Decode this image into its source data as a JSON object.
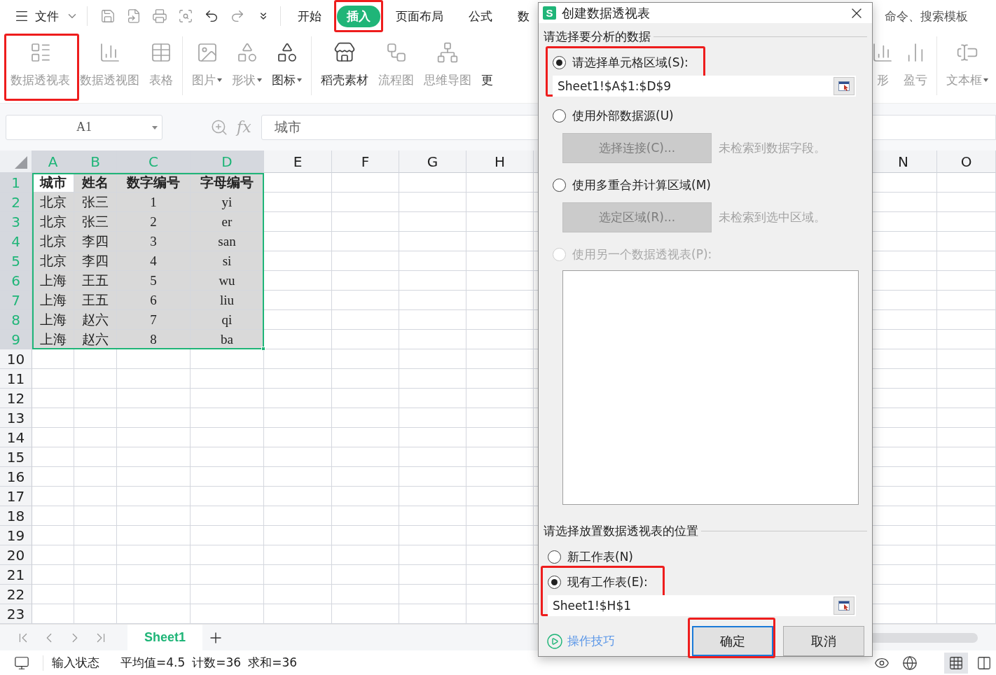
{
  "menu": {
    "file": "文件",
    "tabs": [
      {
        "label": "开始",
        "selected": false,
        "annotated": false
      },
      {
        "label": "插入",
        "selected": true,
        "annotated": true
      },
      {
        "label": "页面布局",
        "selected": false,
        "annotated": false
      },
      {
        "label": "公式",
        "selected": false,
        "annotated": false
      },
      {
        "label": "数",
        "selected": false,
        "annotated": false
      }
    ],
    "search_hint": "命令、搜索模板"
  },
  "ribbon": {
    "groups": [
      [
        {
          "label": "数据透视表",
          "disabled": true,
          "dropdown": false,
          "annotated": true
        },
        {
          "label": "数据透视图",
          "disabled": true,
          "dropdown": false,
          "annotated": false
        },
        {
          "label": "表格",
          "disabled": true,
          "dropdown": false,
          "annotated": false
        }
      ],
      [
        {
          "label": "图片",
          "disabled": true,
          "dropdown": true,
          "annotated": false
        },
        {
          "label": "形状",
          "disabled": true,
          "dropdown": true,
          "annotated": false
        },
        {
          "label": "图标",
          "disabled": false,
          "dropdown": true,
          "annotated": false
        }
      ],
      [
        {
          "label": "稻壳素材",
          "disabled": false,
          "dropdown": false,
          "annotated": false
        },
        {
          "label": "流程图",
          "disabled": true,
          "dropdown": false,
          "annotated": false
        },
        {
          "label": "思维导图",
          "disabled": true,
          "dropdown": false,
          "annotated": false
        },
        {
          "label": "更",
          "disabled": false,
          "dropdown": false,
          "annotated": false
        }
      ]
    ],
    "right_groups": [
      [
        {
          "label": "形",
          "disabled": true,
          "dropdown": false,
          "annotated": false
        },
        {
          "label": "盈亏",
          "disabled": true,
          "dropdown": false,
          "annotated": false
        }
      ],
      [
        {
          "label": "文本框",
          "disabled": true,
          "dropdown": true,
          "annotated": false
        }
      ]
    ]
  },
  "formula_bar": {
    "name_box": "A1",
    "fx": "fx",
    "value": "城市"
  },
  "sheet": {
    "columns": [
      {
        "label": "A",
        "selected": true
      },
      {
        "label": "B",
        "selected": true
      },
      {
        "label": "C",
        "selected": true
      },
      {
        "label": "D",
        "selected": true
      },
      {
        "label": "E",
        "selected": false
      },
      {
        "label": "F",
        "selected": false
      },
      {
        "label": "G",
        "selected": false
      },
      {
        "label": "H",
        "selected": false
      }
    ],
    "far_columns": [
      {
        "label": "N",
        "selected": false
      },
      {
        "label": "O",
        "selected": false
      }
    ],
    "rows": [
      {
        "number": "1",
        "selected": true,
        "kind": "header",
        "cells": [
          {
            "text": "城市",
            "active": true
          },
          {
            "text": "姓名",
            "active": false
          },
          {
            "text": "数字编号",
            "active": false
          },
          {
            "text": "字母编号",
            "active": false
          }
        ]
      },
      {
        "number": "2",
        "selected": true,
        "kind": "data",
        "cells": [
          {
            "text": "北京",
            "active": false
          },
          {
            "text": "张三",
            "active": false
          },
          {
            "text": "1",
            "active": false
          },
          {
            "text": "yi",
            "active": false
          }
        ]
      },
      {
        "number": "3",
        "selected": true,
        "kind": "data",
        "cells": [
          {
            "text": "北京",
            "active": false
          },
          {
            "text": "张三",
            "active": false
          },
          {
            "text": "2",
            "active": false
          },
          {
            "text": "er",
            "active": false
          }
        ]
      },
      {
        "number": "4",
        "selected": true,
        "kind": "data",
        "cells": [
          {
            "text": "北京",
            "active": false
          },
          {
            "text": "李四",
            "active": false
          },
          {
            "text": "3",
            "active": false
          },
          {
            "text": "san",
            "active": false
          }
        ]
      },
      {
        "number": "5",
        "selected": true,
        "kind": "data",
        "cells": [
          {
            "text": "北京",
            "active": false
          },
          {
            "text": "李四",
            "active": false
          },
          {
            "text": "4",
            "active": false
          },
          {
            "text": "si",
            "active": false
          }
        ]
      },
      {
        "number": "6",
        "selected": true,
        "kind": "data",
        "cells": [
          {
            "text": "上海",
            "active": false
          },
          {
            "text": "王五",
            "active": false
          },
          {
            "text": "5",
            "active": false
          },
          {
            "text": "wu",
            "active": false
          }
        ]
      },
      {
        "number": "7",
        "selected": true,
        "kind": "data",
        "cells": [
          {
            "text": "上海",
            "active": false
          },
          {
            "text": "王五",
            "active": false
          },
          {
            "text": "6",
            "active": false
          },
          {
            "text": "liu",
            "active": false
          }
        ]
      },
      {
        "number": "8",
        "selected": true,
        "kind": "data",
        "cells": [
          {
            "text": "上海",
            "active": false
          },
          {
            "text": "赵六",
            "active": false
          },
          {
            "text": "7",
            "active": false
          },
          {
            "text": "qi",
            "active": false
          }
        ]
      },
      {
        "number": "9",
        "selected": true,
        "kind": "data",
        "cells": [
          {
            "text": "上海",
            "active": false
          },
          {
            "text": "赵六",
            "active": false
          },
          {
            "text": "8",
            "active": false
          },
          {
            "text": "ba",
            "active": false
          }
        ]
      },
      {
        "number": "10",
        "selected": false,
        "kind": "empty"
      },
      {
        "number": "11",
        "selected": false,
        "kind": "empty"
      },
      {
        "number": "12",
        "selected": false,
        "kind": "empty"
      },
      {
        "number": "13",
        "selected": false,
        "kind": "empty"
      },
      {
        "number": "14",
        "selected": false,
        "kind": "empty"
      },
      {
        "number": "15",
        "selected": false,
        "kind": "empty"
      },
      {
        "number": "16",
        "selected": false,
        "kind": "empty"
      },
      {
        "number": "17",
        "selected": false,
        "kind": "empty"
      },
      {
        "number": "18",
        "selected": false,
        "kind": "empty"
      },
      {
        "number": "19",
        "selected": false,
        "kind": "empty"
      },
      {
        "number": "20",
        "selected": false,
        "kind": "empty"
      },
      {
        "number": "21",
        "selected": false,
        "kind": "empty"
      },
      {
        "number": "22",
        "selected": false,
        "kind": "empty"
      },
      {
        "number": "23",
        "selected": false,
        "kind": "empty"
      }
    ]
  },
  "sheet_tabs": [
    {
      "label": "Sheet1",
      "selected": true
    }
  ],
  "status_bar": {
    "mode": "输入状态",
    "stats": [
      "平均值=4.5",
      "计数=36",
      "求和=36"
    ]
  },
  "dialog": {
    "badge": "S",
    "title": "创建数据透视表",
    "sections": [
      {
        "heading": "请选择要分析的数据",
        "options": [
          {
            "kind": "range",
            "label": "请选择单元格区域(S):",
            "selected": true,
            "disabled": false,
            "annotated": true,
            "value": "Sheet1!$A$1:$D$9"
          },
          {
            "kind": "connection",
            "label": "使用外部数据源(U)",
            "selected": false,
            "disabled": false,
            "annotated": false,
            "button": "选择连接(C)...",
            "note": "未检索到数据字段。"
          },
          {
            "kind": "connection",
            "label": "使用多重合并计算区域(M)",
            "selected": false,
            "disabled": false,
            "annotated": false,
            "button": "选定区域(R)...",
            "note": "未检索到选中区域。"
          },
          {
            "kind": "list",
            "label": "使用另一个数据透视表(P):",
            "selected": false,
            "disabled": true,
            "annotated": false
          }
        ]
      },
      {
        "heading": "请选择放置数据透视表的位置",
        "options": [
          {
            "kind": "plain",
            "label": "新工作表(N)",
            "selected": false,
            "disabled": false,
            "annotated": false
          },
          {
            "kind": "range",
            "label": "现有工作表(E):",
            "selected": true,
            "disabled": false,
            "annotated": true,
            "value": "Sheet1!$H$1"
          }
        ]
      }
    ],
    "tips_link": "操作技巧",
    "buttons": [
      {
        "label": "确定",
        "default": true,
        "annotated": true
      },
      {
        "label": "取消",
        "default": false,
        "annotated": false
      }
    ]
  }
}
